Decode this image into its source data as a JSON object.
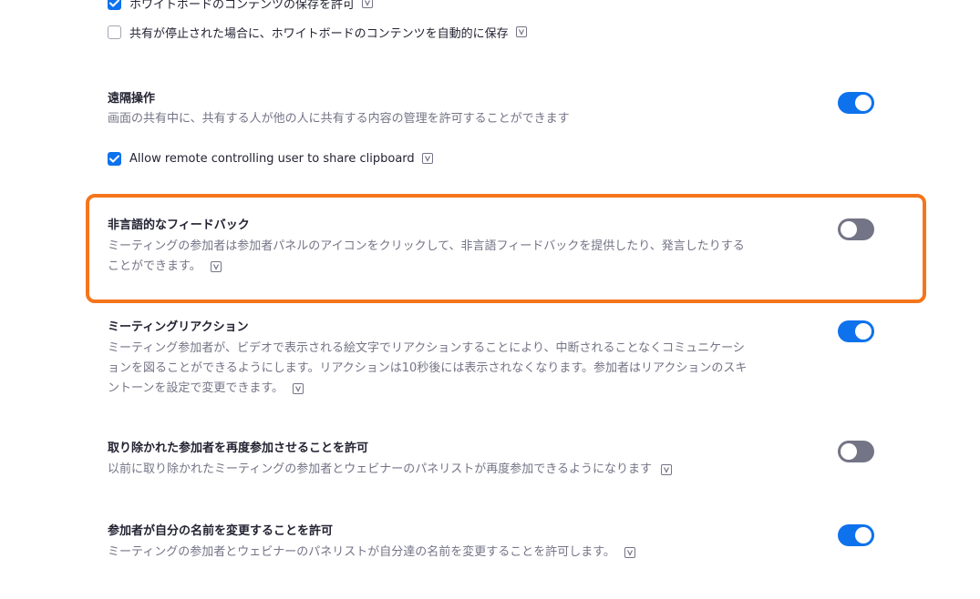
{
  "whiteboard": {
    "allow_save_label": "ホワイトボードのコンテンツの保存を許可",
    "auto_save_label": "共有が停止された場合に、ホワイトボードのコンテンツを自動的に保存"
  },
  "settings": {
    "remote_control": {
      "title": "遠隔操作",
      "description": "画面の共有中に、共有する人が他の人に共有する内容の管理を許可することができます",
      "clipboard_label": "Allow remote controlling user to share clipboard"
    },
    "nonverbal_feedback": {
      "title": "非言語的なフィードバック",
      "description": "ミーティングの参加者は参加者パネルのアイコンをクリックして、非言語フィードバックを提供したり、発言したりすることができます。"
    },
    "meeting_reactions": {
      "title": "ミーティングリアクション",
      "description": "ミーティング参加者が、ビデオで表示される絵文字でリアクションすることにより、中断されることなくコミュニケーションを図ることができるようにします。リアクションは10秒後には表示されなくなります。参加者はリアクションのスキントーンを設定で変更できます。"
    },
    "rejoin_removed": {
      "title": "取り除かれた参加者を再度参加させることを許可",
      "description": "以前に取り除かれたミーティングの参加者とウェビナーのパネリストが再度参加できるようになります"
    },
    "rename_self": {
      "title": "参加者が自分の名前を変更することを許可",
      "description": "ミーティングの参加者とウェビナーのパネリストが自分達の名前を変更することを許可します。"
    }
  },
  "colors": {
    "accent_blue": "#0e72ed",
    "toggle_off": "#747487",
    "highlight_orange": "#f4751c",
    "muted_text": "#747487"
  }
}
